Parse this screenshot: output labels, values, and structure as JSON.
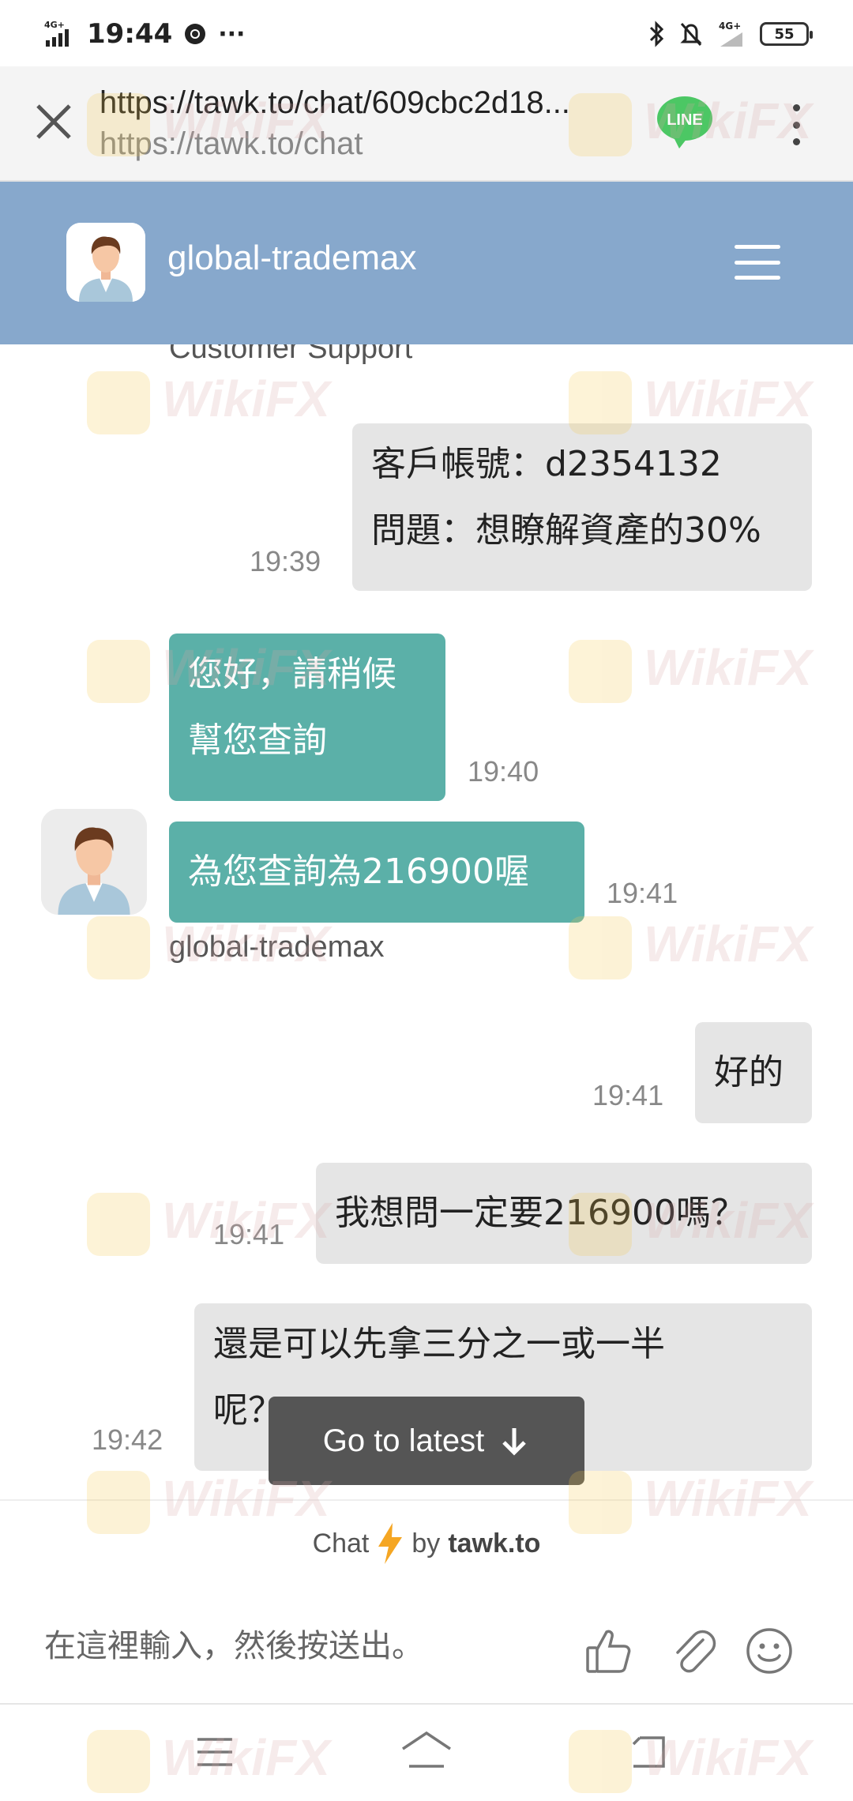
{
  "status_bar": {
    "network": "4G⁺",
    "time": "19:44",
    "dots": "···",
    "network_right": "4G⁺",
    "battery": "55"
  },
  "browser": {
    "url": "https://tawk.to/chat/609cbc2d18...",
    "url_short": "https://tawk.to/chat",
    "line_label": "LINE"
  },
  "chat_header": {
    "name": "global-trademax"
  },
  "messages": {
    "support_label": "Customer Support",
    "m1": {
      "lines": [
        "客戶帳號：d2354132",
        "問題：想瞭解資產的30%"
      ],
      "time": "19:39"
    },
    "m2": {
      "lines": [
        "您好，請稍候",
        "幫您查詢"
      ],
      "time": "19:40"
    },
    "m3": {
      "text": "為您查詢為216900喔",
      "time": "19:41",
      "sender": "global-trademax"
    },
    "m4": {
      "text": "好的",
      "time": "19:41"
    },
    "m5": {
      "text": "我想問一定要216900嗎？",
      "time": "19:41"
    },
    "m6": {
      "lines": [
        "還是可以先拿三分之一或一半",
        "呢？"
      ],
      "time": "19:42"
    }
  },
  "go_latest": "Go to latest",
  "branding": {
    "chat": "Chat",
    "by": "by",
    "brand": "tawk.to"
  },
  "composer": {
    "placeholder": "在這裡輸入，然後按送出。"
  },
  "watermark": "WikiFX",
  "colors": {
    "header_bg": "#87a8cc",
    "agent_bubble": "#5bb0a8",
    "visitor_bubble": "#e5e5e5",
    "go_latest_bg": "#555555"
  }
}
